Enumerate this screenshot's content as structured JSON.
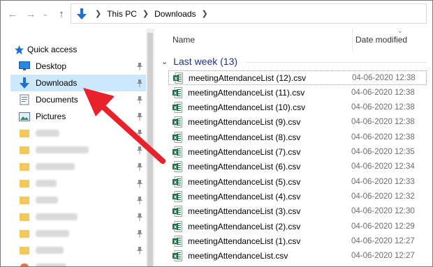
{
  "address": {
    "crumbs": [
      "This PC",
      "Downloads"
    ]
  },
  "nav": {
    "quick_access": "Quick access",
    "items": [
      {
        "label": "Desktop",
        "icon": "desktop-icon",
        "pinned": true
      },
      {
        "label": "Downloads",
        "icon": "download-arrow-icon",
        "pinned": true,
        "selected": true
      },
      {
        "label": "Documents",
        "icon": "documents-icon",
        "pinned": true
      },
      {
        "label": "Pictures",
        "icon": "pictures-icon",
        "pinned": true
      }
    ]
  },
  "columns": {
    "name": "Name",
    "date": "Date modified"
  },
  "group": {
    "label": "Last week (13)"
  },
  "files": [
    {
      "name": "meetingAttendanceList (12).csv",
      "date": "04-06-2020 12:38"
    },
    {
      "name": "meetingAttendanceList (11).csv",
      "date": "04-06-2020 12:38"
    },
    {
      "name": "meetingAttendanceList (10).csv",
      "date": "04-06-2020 12:38"
    },
    {
      "name": "meetingAttendanceList (9).csv",
      "date": "04-06-2020 12:38"
    },
    {
      "name": "meetingAttendanceList (8).csv",
      "date": "04-06-2020 12:38"
    },
    {
      "name": "meetingAttendanceList (7).csv",
      "date": "04-06-2020 12:35"
    },
    {
      "name": "meetingAttendanceList (6).csv",
      "date": "04-06-2020 12:34"
    },
    {
      "name": "meetingAttendanceList (5).csv",
      "date": "04-06-2020 12:33"
    },
    {
      "name": "meetingAttendanceList (4).csv",
      "date": "04-06-2020 12:32"
    },
    {
      "name": "meetingAttendanceList (3).csv",
      "date": "04-06-2020 12:30"
    },
    {
      "name": "meetingAttendanceList (2).csv",
      "date": "04-06-2020 12:29"
    },
    {
      "name": "meetingAttendanceList (1).csv",
      "date": "04-06-2020 12:27"
    },
    {
      "name": "meetingAttendanceList.csv",
      "date": "04-06-2020 12:27"
    }
  ],
  "colors": {
    "selection": "#cce8ff",
    "group_header": "#1e3287",
    "excel_green": "#1d7044",
    "annotation_arrow": "#e8212a",
    "folder_yellow": "#f2c75c"
  }
}
